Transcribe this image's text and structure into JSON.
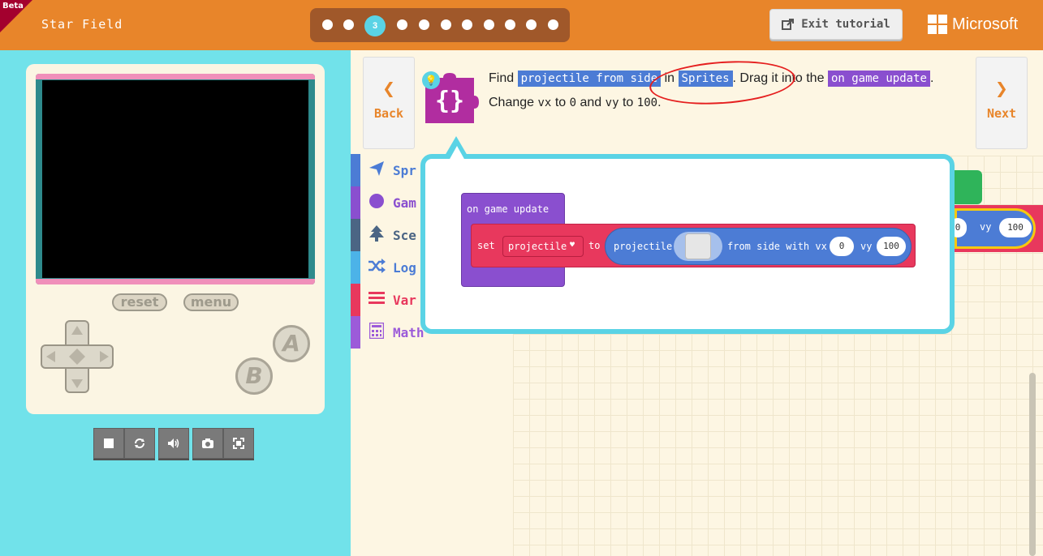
{
  "header": {
    "beta_label": "Beta",
    "app_title": "Star Field",
    "step_active": "3",
    "exit_label": "Exit tutorial",
    "brand": "Microsoft"
  },
  "simulator": {
    "reset_label": "reset",
    "menu_label": "menu",
    "a_label": "A",
    "b_label": "B"
  },
  "tutorial": {
    "back_label": "Back",
    "next_label": "Next",
    "text_find": "Find",
    "chip_block": "projectile from side",
    "text_in": "in",
    "chip_category": "Sprites",
    "text_drag": ". Drag it into the",
    "chip_event": "on game update",
    "text_period": ".",
    "text_change": "Change",
    "code_vx": "vx",
    "text_to1": "to",
    "code_0": "0",
    "text_and": "and",
    "code_vy": "vy",
    "text_to2": "to",
    "code_100": "100",
    "text_end": "."
  },
  "toolbox": {
    "categories": [
      {
        "name": "Spr",
        "color": "#4c7cd5"
      },
      {
        "name": "Gam",
        "color": "#8a4fcf"
      },
      {
        "name": "Sce",
        "color": "#4b6584"
      },
      {
        "name": "Log",
        "color": "#4cb3e8"
      },
      {
        "name": "Var",
        "color": "#e8385d"
      },
      {
        "name": "Math",
        "color": "#9c5bd9"
      }
    ]
  },
  "hint_blocks": {
    "event_label": "on game update",
    "set_label": "set",
    "var_label": "projectile",
    "to_label": "to",
    "fn_label": "projectile",
    "from_label": "from side with vx",
    "vx_value": "0",
    "vy_label": "vy",
    "vy_value": "100"
  },
  "workspace": {
    "bg_vx_value": "0",
    "bg_vy_label": "vy",
    "bg_vy_value": "100"
  }
}
